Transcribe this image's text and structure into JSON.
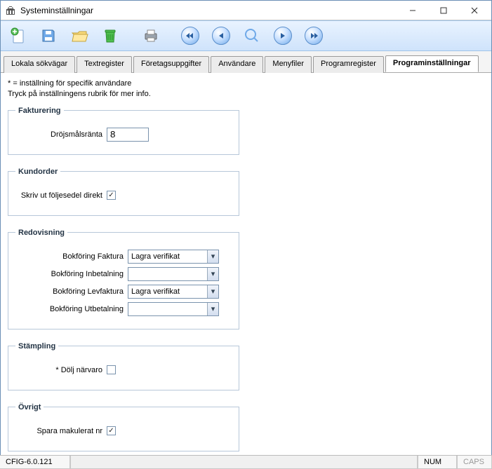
{
  "window": {
    "title": "Systeminställningar"
  },
  "tabs": [
    {
      "label": "Lokala sökvägar"
    },
    {
      "label": "Textregister"
    },
    {
      "label": "Företagsuppgifter"
    },
    {
      "label": "Användare"
    },
    {
      "label": "Menyfiler"
    },
    {
      "label": "Programregister"
    },
    {
      "label": "Programinställningar"
    }
  ],
  "help": {
    "line1": "* = inställning för specifik användare",
    "line2": "Tryck på inställningens rubrik för mer info."
  },
  "fakturering": {
    "legend": "Fakturering",
    "interest_label": "Dröjsmålsränta",
    "interest_value": "8"
  },
  "kundorder": {
    "legend": "Kundorder",
    "print_label": "Skriv ut följesedel direkt",
    "print_checked": true
  },
  "redovisning": {
    "legend": "Redovisning",
    "faktura_label": "Bokföring Faktura",
    "faktura_value": "Lagra verifikat",
    "inbet_label": "Bokföring Inbetalning",
    "inbet_value": "",
    "levfaktura_label": "Bokföring Levfaktura",
    "levfaktura_value": "Lagra verifikat",
    "utbet_label": "Bokföring Utbetalning",
    "utbet_value": ""
  },
  "stampling": {
    "legend": "Stämpling",
    "hide_label": "* Dölj närvaro",
    "hide_checked": false
  },
  "ovrigt": {
    "legend": "Övrigt",
    "save_label": "Spara makulerat nr",
    "save_checked": true
  },
  "status": {
    "version": "CFIG-6.0.121",
    "num": "NUM",
    "caps": "CAPS"
  }
}
